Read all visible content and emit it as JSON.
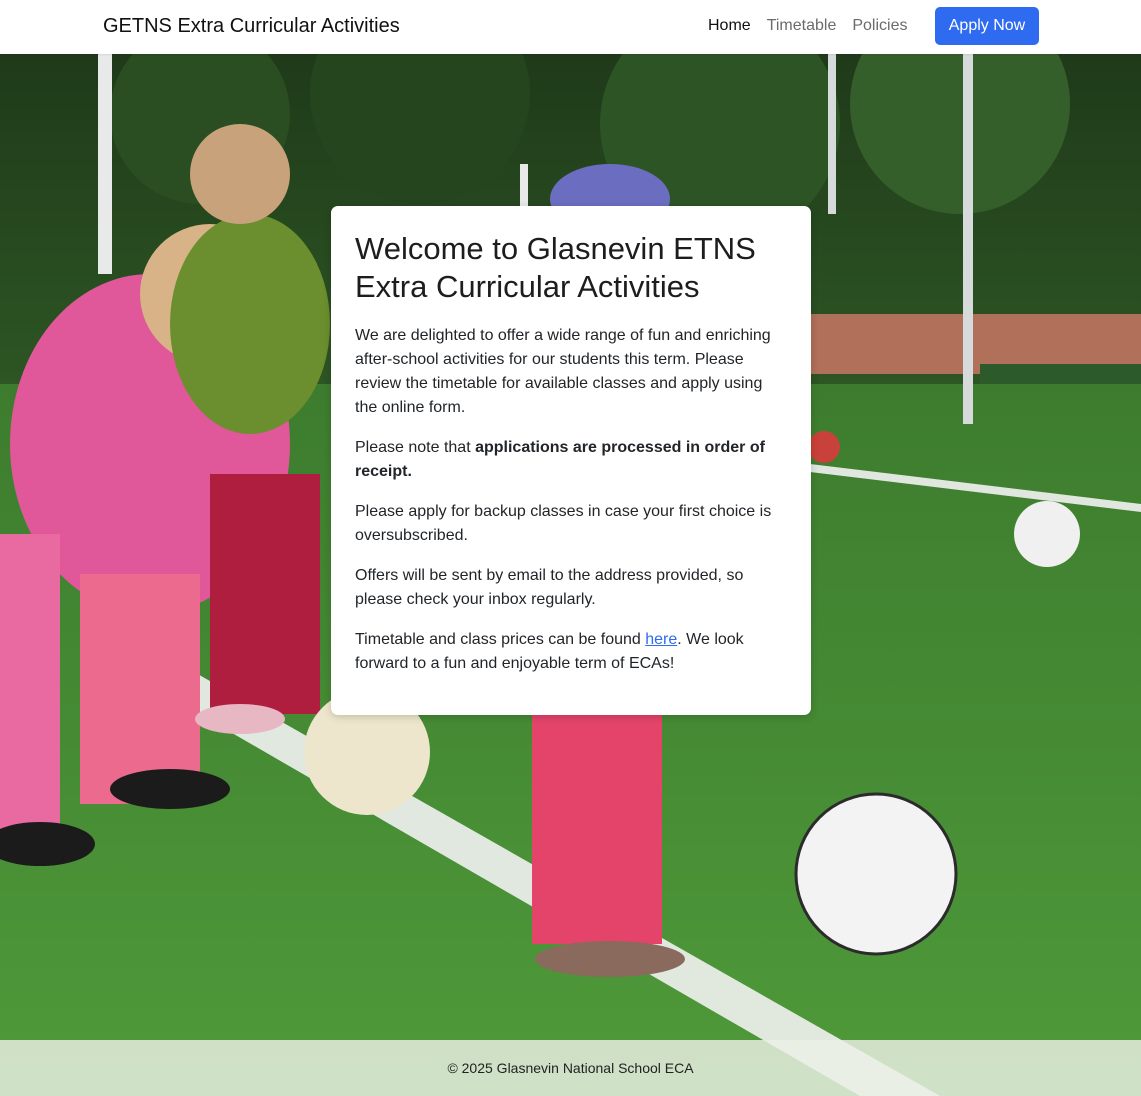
{
  "nav": {
    "brand": "GETNS Extra Curricular Activities",
    "links": [
      {
        "label": "Home",
        "active": true
      },
      {
        "label": "Timetable",
        "active": false
      },
      {
        "label": "Policies",
        "active": false
      }
    ],
    "apply_label": "Apply Now"
  },
  "card": {
    "title": "Welcome to Glasnevin ETNS Extra Curricular Activities",
    "p1": "We are delighted to offer a wide range of fun and enriching after-school activities for our students this term. Please review the timetable for available classes and apply using the online form.",
    "p2_prefix": "Please note that ",
    "p2_bold": "applications are processed in order of receipt.",
    "p3": "Please apply for backup classes in case your first choice is oversubscribed.",
    "p4": "Offers will be sent by email to the address provided, so please check your inbox regularly.",
    "p5_prefix": "Timetable and class prices can be found ",
    "p5_link": "here",
    "p5_suffix": ". We look forward to a fun and enjoyable term of ECAs!"
  },
  "footer": {
    "text": "© 2025 Glasnevin National School ECA"
  },
  "colors": {
    "accent": "#2f6bf0",
    "pitch": "#4c8f3a"
  }
}
